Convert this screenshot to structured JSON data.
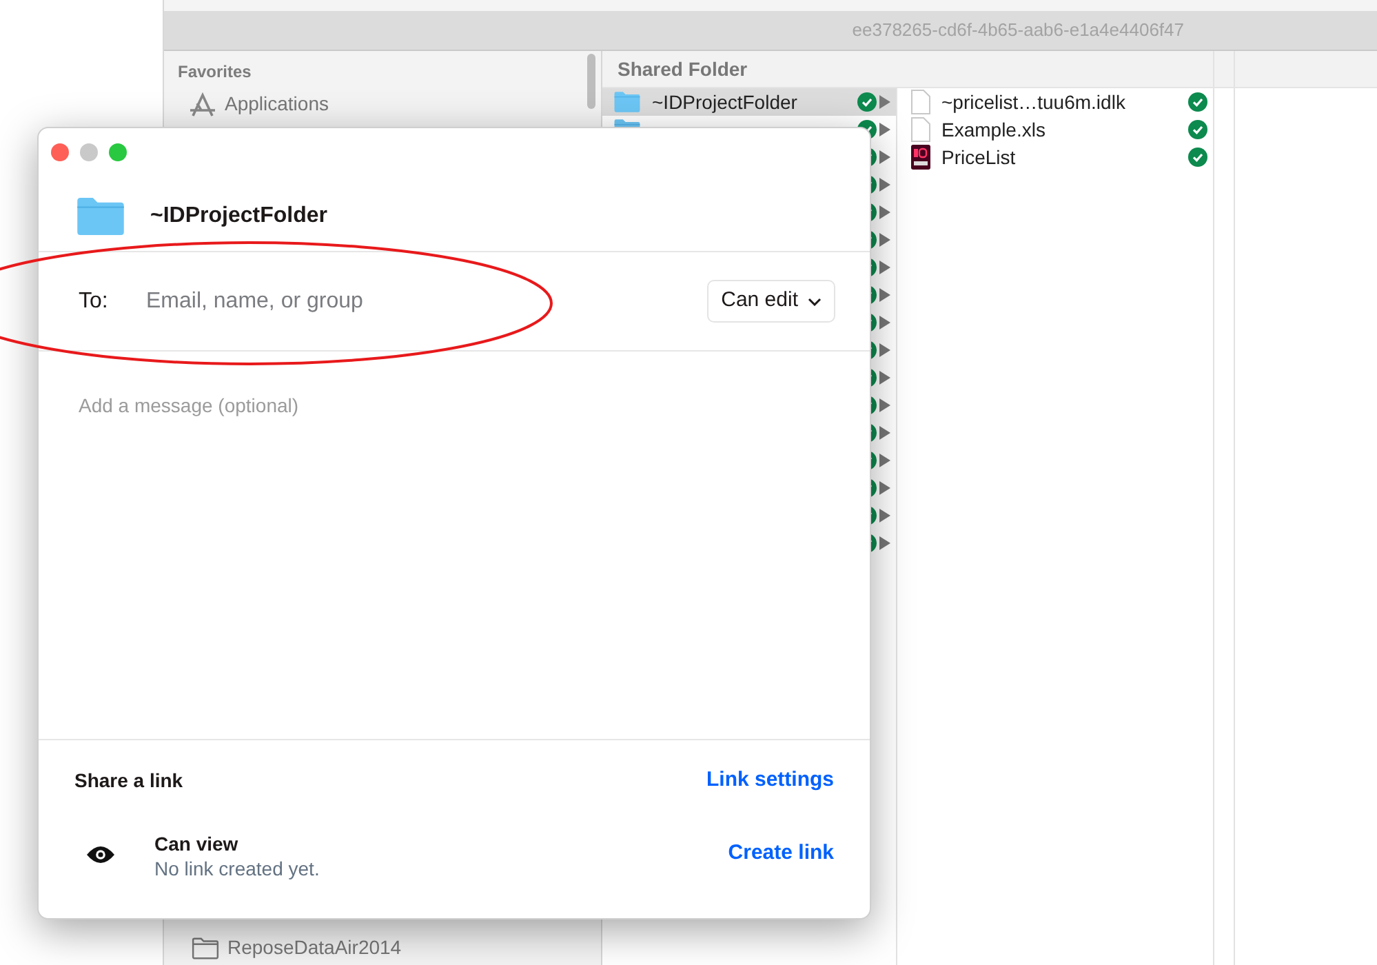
{
  "finder": {
    "path": "ee378265-cd6f-4b65-aab6-e1a4e4406f47",
    "sidebar": {
      "heading": "Favorites",
      "items": [
        {
          "label": "Applications",
          "kind": "apps"
        }
      ],
      "bottom_item": {
        "label": "ReposeDataAir2014",
        "kind": "folder"
      }
    },
    "column_heading": "Shared Folder",
    "folders": [
      {
        "name": "~IDProjectFolder",
        "selected": true
      },
      {
        "kind": "folder",
        "selected": false
      },
      {
        "selected": false
      },
      {
        "selected": false
      },
      {
        "selected": false
      },
      {
        "selected": false
      },
      {
        "selected": false
      },
      {
        "selected": false
      },
      {
        "selected": false
      },
      {
        "selected": false
      },
      {
        "selected": false
      },
      {
        "selected": false
      },
      {
        "selected": false
      },
      {
        "selected": false
      },
      {
        "selected": false
      },
      {
        "selected": false
      },
      {
        "selected": false
      }
    ],
    "files": [
      {
        "name": "~pricelist…tuu6m.idlk",
        "kind": "doc"
      },
      {
        "name": "Example.xls",
        "kind": "doc"
      },
      {
        "name": "PriceList",
        "kind": "indesign"
      }
    ]
  },
  "dialog": {
    "folder_name": "~IDProjectFolder",
    "to_label": "To:",
    "to_placeholder": "Email, name, or group",
    "permission": "Can edit",
    "message_placeholder": "Add a message (optional)",
    "share_heading": "Share a link",
    "link_settings": "Link settings",
    "link_access": "Can view",
    "link_status": "No link created yet.",
    "create_link": "Create link"
  }
}
